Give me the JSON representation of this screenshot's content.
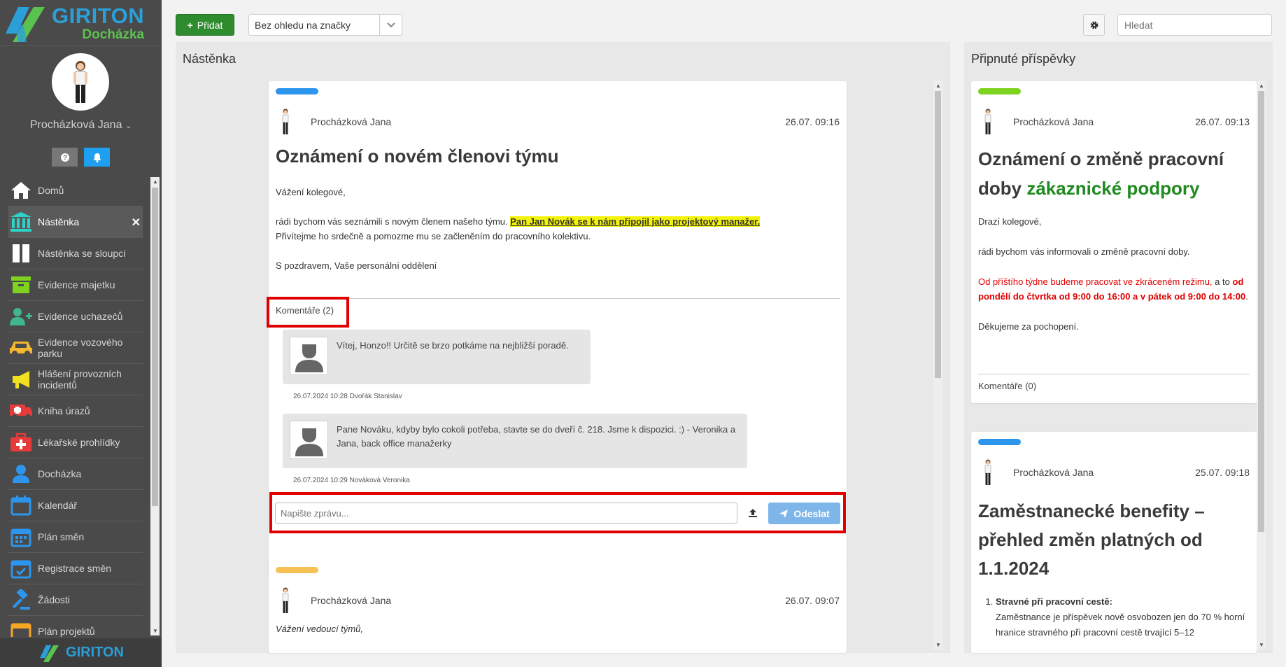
{
  "app": {
    "brand": "GIRITON",
    "product": "Docházka",
    "footer_brand": "GIRITON"
  },
  "user": {
    "name": "Procházková Jana"
  },
  "sidebar": {
    "items": [
      {
        "label": "Domů",
        "icon": "home-icon"
      },
      {
        "label": "Nástěnka",
        "icon": "bank-icon",
        "active": true
      },
      {
        "label": "Nástěnka se sloupci",
        "icon": "columns-icon"
      },
      {
        "label": "Evidence majetku",
        "icon": "archive-icon"
      },
      {
        "label": "Evidence uchazečů",
        "icon": "user-plus-icon"
      },
      {
        "label": "Evidence vozového parku",
        "icon": "car-icon"
      },
      {
        "label": "Hlášení provozních incidentů",
        "icon": "megaphone-icon"
      },
      {
        "label": "Kniha úrazů",
        "icon": "ambulance-icon"
      },
      {
        "label": "Lékařské prohlídky",
        "icon": "medkit-icon"
      },
      {
        "label": "Docházka",
        "icon": "user-icon"
      },
      {
        "label": "Kalendář",
        "icon": "calendar-icon"
      },
      {
        "label": "Plán směn",
        "icon": "calendar-grid-icon"
      },
      {
        "label": "Registrace směn",
        "icon": "calendar-check-icon"
      },
      {
        "label": "Žádosti",
        "icon": "gavel-icon"
      },
      {
        "label": "Plán projektů",
        "icon": "calendar-orange-icon"
      }
    ],
    "close_symbol": "✕"
  },
  "toolbar": {
    "add_label": "Přidat",
    "tag_filter_value": "Bez ohledu na značky",
    "search_placeholder": "Hledat"
  },
  "board": {
    "title": "Nástěnka",
    "posts": [
      {
        "tag_color": "#2d95ec",
        "author": "Procházková Jana",
        "date": "26.07. 09:16",
        "title": "Oznámení o novém členovi týmu",
        "greeting": "Vážení kolegové,",
        "body_1": "rádi bychom vás seznámili s novým členem našeho týmu.",
        "highlight": "Pan Jan Novák se k nám připojil jako projektový manažer.",
        "body_2": "Přivítejme ho srdečně a pomozme mu se začleněním do pracovního kolektivu.",
        "signature": "S pozdravem, Vaše personální oddělení",
        "comments_label": "Komentáře (2)",
        "comments": [
          {
            "text": "Vítej, Honzo!! Určitě se brzo potkáme na nejbližší poradě.",
            "meta": "26.07.2024 10:28 Dvořák Stanislav"
          },
          {
            "text": "Pane Nováku, kdyby bylo cokoli potřeba, stavte se do dveří č. 218. Jsme k dispozici. :) - Veronika a Jana, back office manažerky",
            "meta": "26.07.2024 10:29 Nováková Veronika"
          }
        ],
        "message_placeholder": "Napište zprávu...",
        "send_label": "Odeslat"
      },
      {
        "tag_color": "#f7c155",
        "author": "Procházková Jana",
        "date": "26.07. 09:07",
        "greeting": "Vážení vedoucí týmů,"
      }
    ]
  },
  "pinned": {
    "title": "Připnuté příspěvky",
    "posts": [
      {
        "tag_color": "#7ed321",
        "author": "Procházková Jana",
        "date": "26.07. 09:13",
        "title_1": "Oznámení o změně pracovní doby",
        "title_2": "zákaznické podpory",
        "greeting": "Drazí kolegové,",
        "body_1": "rádi bychom vás informovali o změně pracovní doby.",
        "red_1": "Od příštího týdne budeme pracovat ve zkráceném režimu,",
        "mid": "a to",
        "red_bold": "od pondělí do čtvrtka od 9:00 do 16:00 a v pátek od 9:00 do 14:00",
        "end": ".",
        "thanks": "Děkujeme za pochopení.",
        "comments_label": "Komentáře (0)"
      },
      {
        "tag_color": "#2d95ec",
        "author": "Procházková Jana",
        "date": "25.07. 09:18",
        "title": "Zaměstnanecké benefity – přehled změn platných od 1.1.2024",
        "item_1_title": "Stravné při pracovní cestě:",
        "item_1_text": "Zaměstnance je příspěvek nově osvobozen jen do 70 % horní hranice stravného při pracovní cestě trvající 5–12"
      }
    ]
  }
}
